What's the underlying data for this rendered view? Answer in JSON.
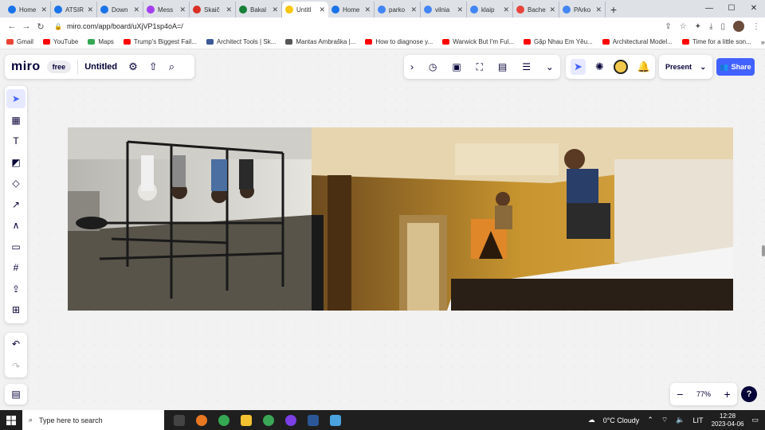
{
  "browser": {
    "tabs": [
      {
        "label": "Home",
        "color": "#1a73e8"
      },
      {
        "label": "ATSIR",
        "color": "#1a73e8"
      },
      {
        "label": "Down",
        "color": "#1a73e8"
      },
      {
        "label": "Mess",
        "color": "#a33ff0"
      },
      {
        "label": "Skaič",
        "color": "#d93025"
      },
      {
        "label": "Bakal",
        "color": "#188038"
      },
      {
        "label": "Untitl",
        "color": "#f9c80e",
        "active": true
      },
      {
        "label": "Home",
        "color": "#1a73e8"
      },
      {
        "label": "parko",
        "color": "#4285f4"
      },
      {
        "label": "vilnia",
        "color": "#4285f4"
      },
      {
        "label": "klaip",
        "color": "#4285f4"
      },
      {
        "label": "Bache",
        "color": "#e8453c"
      },
      {
        "label": "PArko",
        "color": "#4285f4"
      }
    ],
    "new_tab": "+",
    "url": "miro.com/app/board/uXjVP1sp4oA=/",
    "bookmarks": [
      {
        "label": "Gmail",
        "color": "#ea4335"
      },
      {
        "label": "YouTube",
        "color": "#ff0000"
      },
      {
        "label": "Maps",
        "color": "#34a853"
      },
      {
        "label": "Trump's Biggest Fail...",
        "color": "#ff0000"
      },
      {
        "label": "Architect Tools | Sk...",
        "color": "#3b5998"
      },
      {
        "label": "Mantas Ambraška |...",
        "color": "#555555"
      },
      {
        "label": "How to diagnose y...",
        "color": "#ff0000"
      },
      {
        "label": "Warwick But I'm Ful...",
        "color": "#ff0000"
      },
      {
        "label": "Gặp Nhau Em Yêu...",
        "color": "#ff0000"
      },
      {
        "label": "Architectural Model...",
        "color": "#ff0000"
      },
      {
        "label": "Time for a little son...",
        "color": "#ff0000"
      }
    ],
    "bookmarks_more": "»"
  },
  "miro": {
    "logo": "miro",
    "plan": "free",
    "board_name": "Untitled",
    "present_label": "Present",
    "share_label": "Share",
    "zoom_level": "77%"
  },
  "taskbar": {
    "search_placeholder": "Type here to search",
    "weather": "0°C  Cloudy",
    "lang": "LIT",
    "time": "12:28",
    "date": "2023-04-06"
  }
}
